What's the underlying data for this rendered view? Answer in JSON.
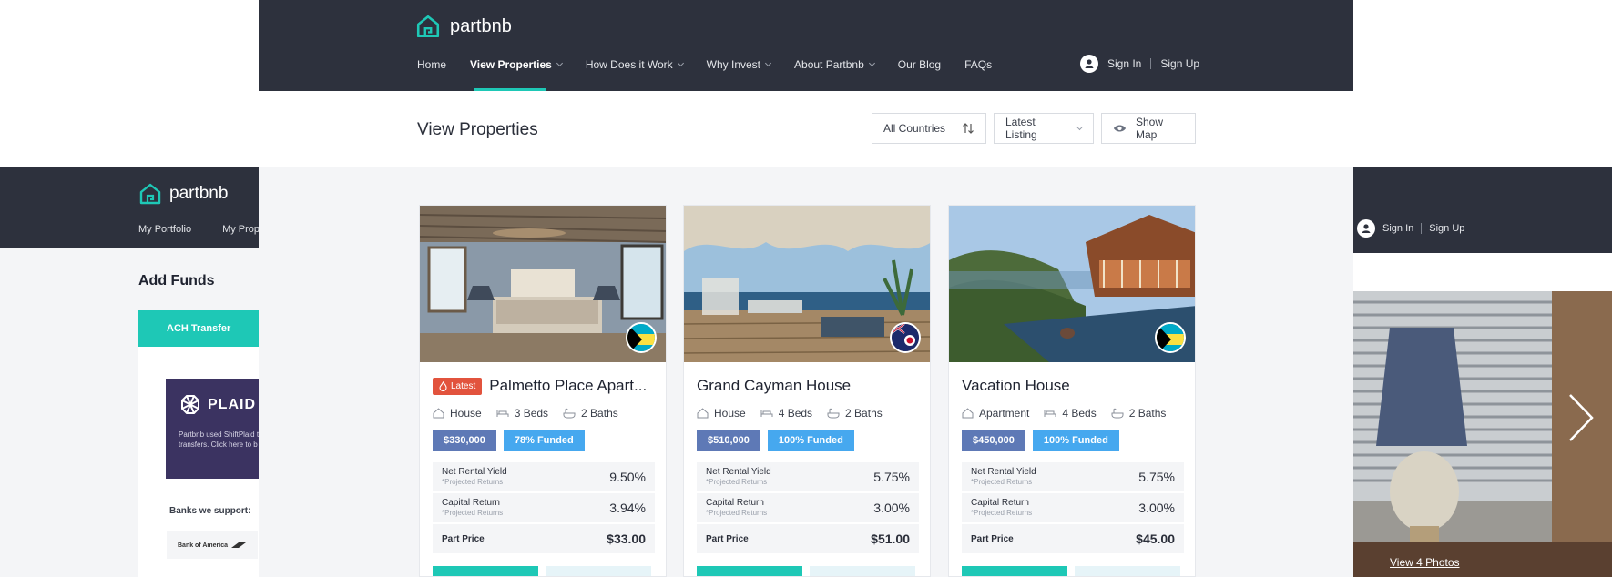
{
  "app": {
    "brand": "partbnb"
  },
  "header": {
    "nav": [
      {
        "label": "Home",
        "dropdown": false,
        "active": false
      },
      {
        "label": "View Properties",
        "dropdown": true,
        "active": true
      },
      {
        "label": "How Does it Work",
        "dropdown": true,
        "active": false
      },
      {
        "label": "Why Invest",
        "dropdown": true,
        "active": false
      },
      {
        "label": "About Partbnb",
        "dropdown": true,
        "active": false
      },
      {
        "label": "Our Blog",
        "dropdown": false,
        "active": false
      },
      {
        "label": "FAQs",
        "dropdown": false,
        "active": false
      }
    ],
    "sign_in": "Sign In",
    "sign_up": "Sign Up"
  },
  "page": {
    "title": "View Properties",
    "filters": {
      "country": "All Countries",
      "sort": "Latest Listing",
      "map": "Show Map"
    }
  },
  "cards": [
    {
      "latest": true,
      "latest_label": "Latest",
      "title": "Palmetto Place Apart...",
      "type": "House",
      "beds": "3 Beds",
      "baths": "2 Baths",
      "price": "$330,000",
      "funded": "78% Funded",
      "net_yield_label": "Net Rental Yield",
      "projected": "*Projected Returns",
      "net_yield": "9.50%",
      "capital_label": "Capital Return",
      "capital": "3.94%",
      "part_price_label": "Part Price",
      "part_price": "$33.00",
      "flag": "bahamas"
    },
    {
      "latest": false,
      "title": "Grand Cayman House",
      "type": "House",
      "beds": "4 Beds",
      "baths": "2 Baths",
      "price": "$510,000",
      "funded": "100% Funded",
      "net_yield_label": "Net Rental Yield",
      "projected": "*Projected Returns",
      "net_yield": "5.75%",
      "capital_label": "Capital Return",
      "capital": "3.00%",
      "part_price_label": "Part Price",
      "part_price": "$51.00",
      "flag": "cayman"
    },
    {
      "latest": false,
      "title": "Vacation House",
      "type": "Apartment",
      "beds": "4 Beds",
      "baths": "2 Baths",
      "price": "$450,000",
      "funded": "100% Funded",
      "net_yield_label": "Net Rental Yield",
      "projected": "*Projected Returns",
      "net_yield": "5.75%",
      "capital_label": "Capital Return",
      "capital": "3.00%",
      "part_price_label": "Part Price",
      "part_price": "$45.00",
      "flag": "bahamas"
    }
  ],
  "left_window": {
    "brand": "partbnb",
    "nav": [
      "My Portfolio",
      "My Prope"
    ],
    "title": "Add Funds",
    "tab": "ACH Transfer",
    "plaid_logo": "PLAID",
    "plaid_text_1": "Partbnb used ShiftPlaid t",
    "plaid_text_2": "transfers. Click here to b",
    "banks_label": "Banks we support:",
    "bank_logo": "Bank of America"
  },
  "right_window": {
    "sign_in": "Sign In",
    "sign_up": "Sign Up",
    "photos_link": "View 4 Photos"
  },
  "colors": {
    "dark": "#2d313d",
    "accent": "#1ec8b6",
    "latest": "#e2533d",
    "price": "#5e79b6",
    "funded": "#46a8ef"
  }
}
